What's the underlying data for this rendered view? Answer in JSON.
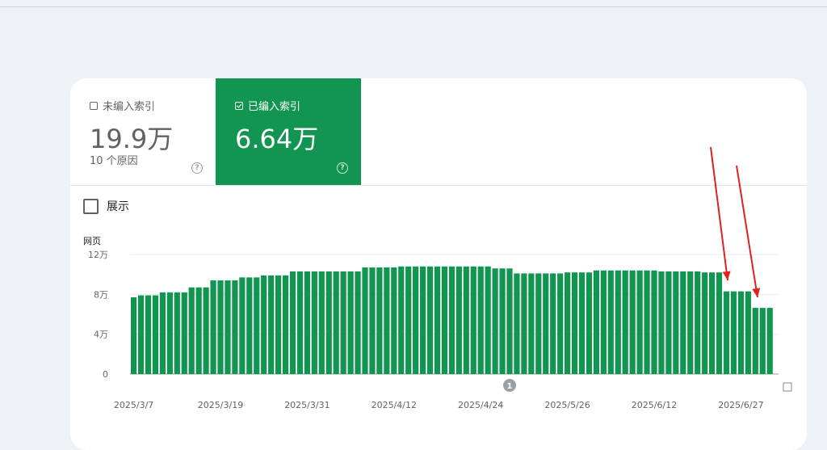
{
  "tiles": {
    "not_indexed": {
      "label": "未编入索引",
      "value": "19.9万",
      "sub": "10 个原因",
      "help": "?"
    },
    "indexed": {
      "label": "已编入索引",
      "value": "6.64万",
      "help": "?"
    }
  },
  "show_toggle": {
    "label": "展示",
    "checked": false
  },
  "annotation_marker": "1",
  "colors": {
    "bar": "#129550",
    "arrow": "#e02020",
    "tile_indexed": "#129550"
  },
  "chart_data": {
    "type": "bar",
    "ylabel": "网页",
    "y_ticks": [
      "12万",
      "8万",
      "4万",
      "0"
    ],
    "y_tick_values": [
      120000,
      80000,
      40000,
      0
    ],
    "ylim": [
      0,
      120000
    ],
    "x_tick_labels": [
      "2025/3/7",
      "2025/3/19",
      "2025/3/31",
      "2025/4/12",
      "2025/4/24",
      "2025/5/26",
      "2025/6/12",
      "2025/6/27"
    ],
    "x_tick_label_index": [
      0,
      12,
      24,
      36,
      48,
      60,
      72,
      84
    ],
    "values": [
      77000,
      79000,
      79000,
      79000,
      82000,
      82000,
      82000,
      82000,
      87000,
      87000,
      87000,
      94000,
      94000,
      94000,
      94000,
      97000,
      97000,
      97000,
      99000,
      99000,
      99000,
      99000,
      103000,
      103000,
      103000,
      103000,
      103000,
      103000,
      103000,
      103000,
      103000,
      103000,
      107000,
      107000,
      107000,
      107000,
      107000,
      108000,
      108000,
      108000,
      108000,
      108000,
      108000,
      108000,
      108000,
      108000,
      108000,
      108000,
      108000,
      108000,
      106000,
      106000,
      106000,
      101000,
      101000,
      101000,
      101000,
      101000,
      101000,
      101000,
      102000,
      102000,
      102000,
      102000,
      104000,
      104000,
      104000,
      104000,
      104000,
      104000,
      104000,
      104000,
      104000,
      103000,
      103000,
      103000,
      103000,
      103000,
      103000,
      102000,
      102000,
      102000,
      83000,
      83000,
      83000,
      83000,
      66400,
      66400,
      66400
    ],
    "grid": true,
    "legend": "none"
  }
}
